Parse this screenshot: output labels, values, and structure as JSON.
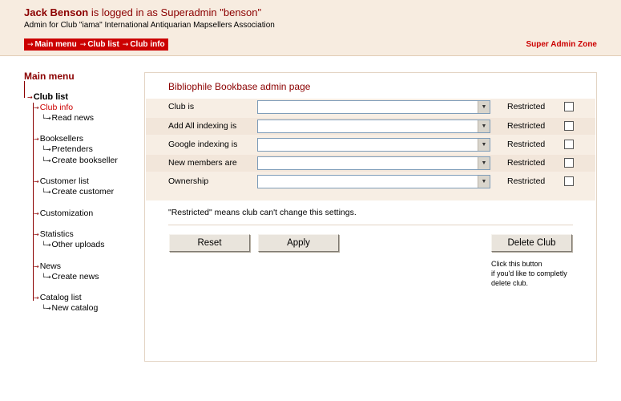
{
  "header": {
    "user_name": "Jack Benson",
    "logged_text": " is logged in as Superadmin \"benson\"",
    "subtitle": "Admin for Club \"iama\" International Antiquarian Mapsellers Association",
    "breadcrumbs": [
      "Main menu",
      "Club list",
      "Club info"
    ],
    "zone_label": "Super Admin Zone",
    "arrow_glyph": "→"
  },
  "sidebar": {
    "main_menu": "Main menu",
    "club_list": "Club list",
    "sections": [
      {
        "label": "Club info",
        "active": true,
        "subs": [
          "Read news"
        ]
      },
      {
        "label": "Booksellers",
        "active": false,
        "subs": [
          "Pretenders",
          "Create bookseller"
        ]
      },
      {
        "label": "Customer list",
        "active": false,
        "subs": [
          "Create customer"
        ]
      },
      {
        "label": "Customization",
        "active": false,
        "subs": []
      },
      {
        "label": "Statistics",
        "active": false,
        "subs": [
          "Other uploads"
        ]
      },
      {
        "label": "News",
        "active": false,
        "subs": [
          "Create news"
        ]
      },
      {
        "label": "Catalog list",
        "active": false,
        "subs": [
          "New catalog"
        ]
      }
    ]
  },
  "panel": {
    "title": "Bibliophile Bookbase admin page",
    "rows": [
      {
        "label": "Club is",
        "value": "",
        "restricted_label": "Restricted",
        "restricted": false
      },
      {
        "label": "Add All indexing is",
        "value": "",
        "restricted_label": "Restricted",
        "restricted": false
      },
      {
        "label": "Google indexing is",
        "value": "",
        "restricted_label": "Restricted",
        "restricted": false
      },
      {
        "label": "New members are",
        "value": "",
        "restricted_label": "Restricted",
        "restricted": false
      },
      {
        "label": "Ownership",
        "value": "",
        "restricted_label": "Restricted",
        "restricted": false
      }
    ],
    "note": "\"Restricted\" means club can't change this settings.",
    "reset_label": "Reset",
    "apply_label": "Apply",
    "delete_label": "Delete Club",
    "delete_note": [
      "Click this button",
      "if you'd like to completly",
      "delete club."
    ]
  },
  "colors": {
    "header_bg": "#f7ece0",
    "accent_red": "#cc0000",
    "dark_red": "#8b0000",
    "panel_row_bg": "#f7eee4"
  }
}
